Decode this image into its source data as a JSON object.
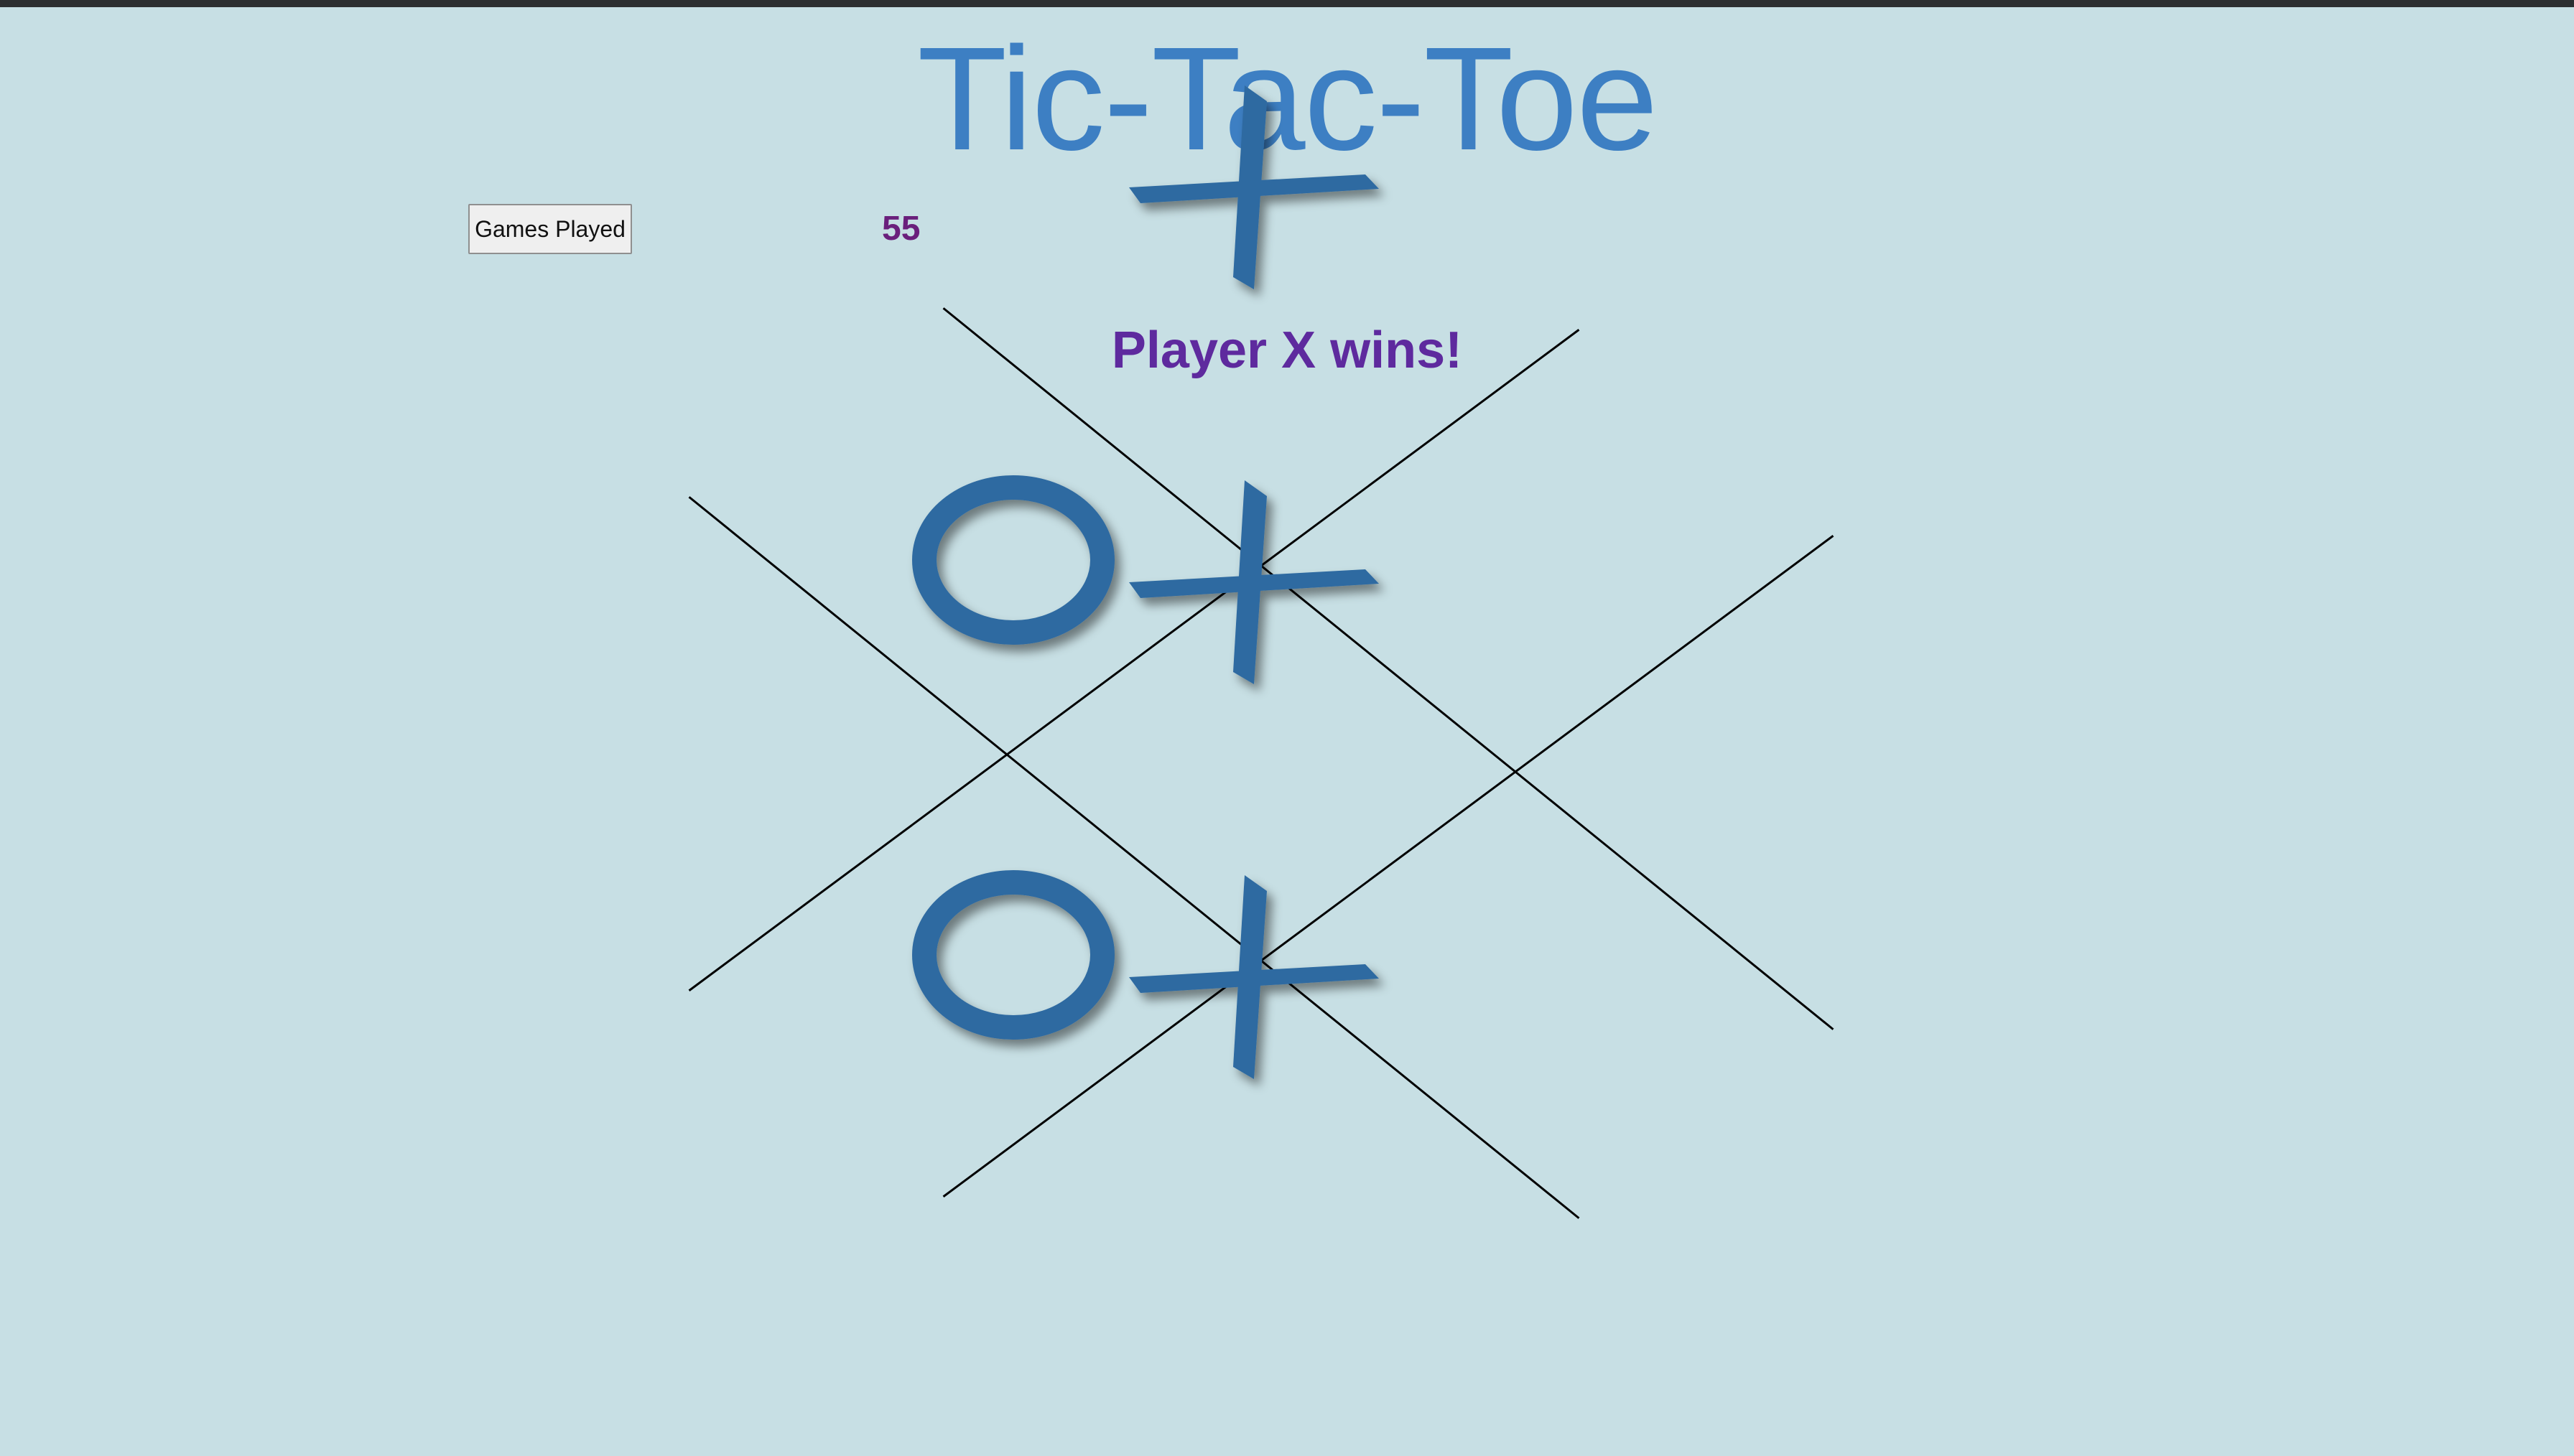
{
  "title": "Tic-Tac-Toe",
  "games_played": {
    "button_label": "Games Played",
    "count": "55"
  },
  "status": "Player X wins!",
  "board": {
    "cells": [
      [
        "X",
        "",
        ""
      ],
      [
        "O",
        "X",
        ""
      ],
      [
        "",
        "O",
        "X"
      ]
    ]
  },
  "colors": {
    "background": "#c7dfe4",
    "title": "#3d7fc3",
    "count": "#6a1f7c",
    "status": "#5e2a9e",
    "piece": "#2f6aa1",
    "grid_line": "#000000"
  }
}
